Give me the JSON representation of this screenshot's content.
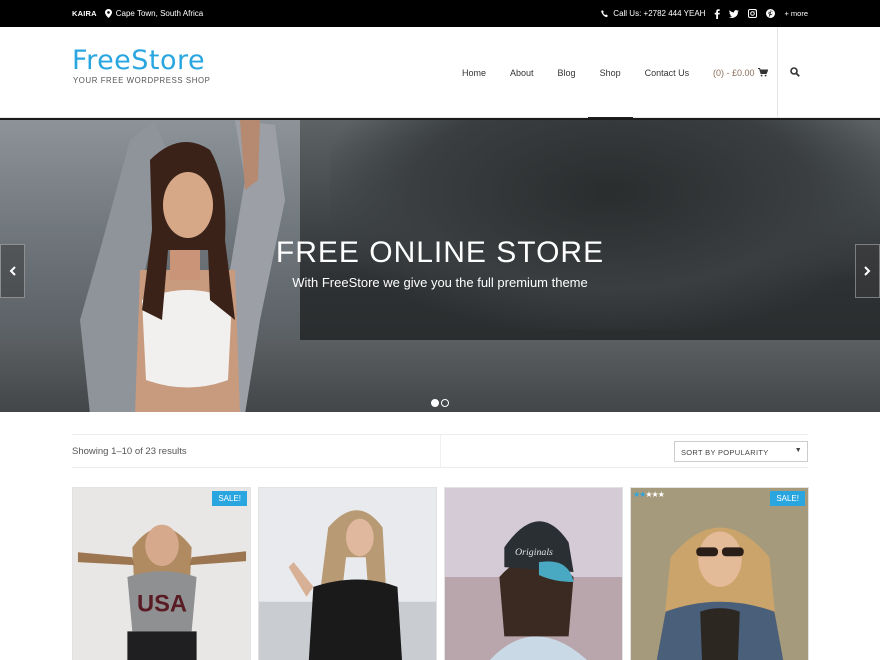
{
  "topbar": {
    "brand": "KAIRA",
    "location": "Cape Town, South Africa",
    "phone": "Call Us: +2782 444 YEAH",
    "social_icons": [
      "facebook-icon",
      "twitter-icon",
      "instagram-icon",
      "pinterest-icon"
    ],
    "more": "+ more"
  },
  "header": {
    "logo": "FreeStore",
    "tagline": "YOUR FREE WORDPRESS SHOP",
    "nav": [
      "Home",
      "About",
      "Blog",
      "Shop",
      "Contact Us"
    ],
    "active_nav": "Shop",
    "cart": "(0) - £0.00"
  },
  "hero": {
    "title": "FREE ONLINE STORE",
    "subtitle": "With FreeStore we give you the full premium theme",
    "slides": 2,
    "active_slide": 1
  },
  "shop": {
    "result_count": "Showing 1–10 of 23 results",
    "sort_value": "SORT BY POPULARITY"
  },
  "products": [
    {
      "badge": "SALE!",
      "rating_stars": 0
    },
    {
      "badge": "",
      "rating_stars": 0
    },
    {
      "badge": "",
      "rating_stars": 0
    },
    {
      "badge": "SALE!",
      "rating_stars": 2
    }
  ],
  "colors": {
    "accent": "#29a6e0",
    "topbar": "#000000"
  }
}
